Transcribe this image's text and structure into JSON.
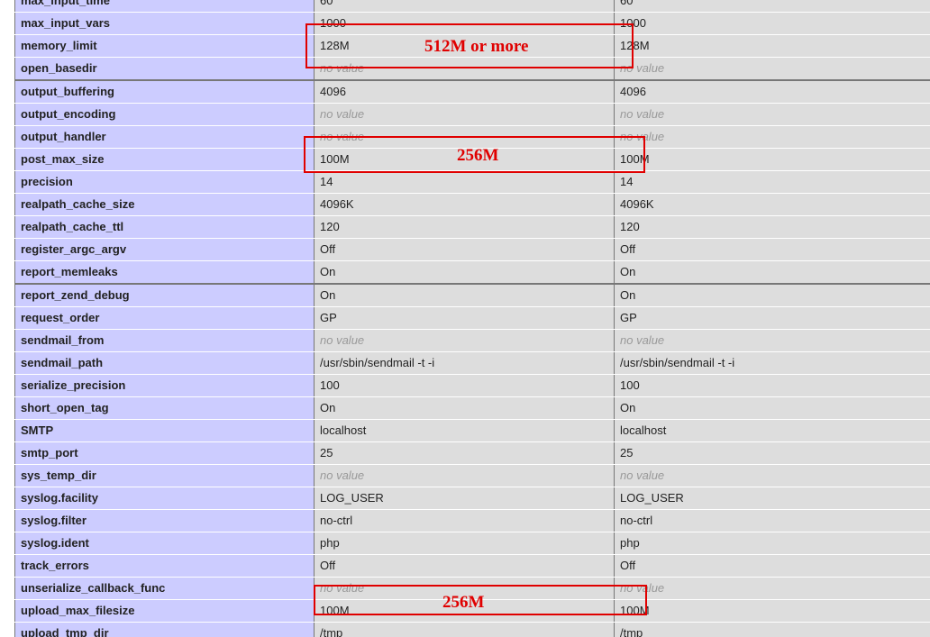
{
  "directives": [
    {
      "name": "max_input_time",
      "local": "60",
      "master": "60"
    },
    {
      "name": "max_input_vars",
      "local": "1000",
      "master": "1000"
    },
    {
      "name": "memory_limit",
      "local": "128M",
      "master": "128M"
    },
    {
      "name": "open_basedir",
      "local": "no value",
      "master": "no value",
      "no_value": true
    },
    {
      "name": "output_buffering",
      "local": "4096",
      "master": "4096",
      "separator": true
    },
    {
      "name": "output_encoding",
      "local": "no value",
      "master": "no value",
      "no_value": true
    },
    {
      "name": "output_handler",
      "local": "no value",
      "master": "no value",
      "no_value": true
    },
    {
      "name": "post_max_size",
      "local": "100M",
      "master": "100M"
    },
    {
      "name": "precision",
      "local": "14",
      "master": "14"
    },
    {
      "name": "realpath_cache_size",
      "local": "4096K",
      "master": "4096K"
    },
    {
      "name": "realpath_cache_ttl",
      "local": "120",
      "master": "120"
    },
    {
      "name": "register_argc_argv",
      "local": "Off",
      "master": "Off"
    },
    {
      "name": "report_memleaks",
      "local": "On",
      "master": "On"
    },
    {
      "name": "report_zend_debug",
      "local": "On",
      "master": "On",
      "separator": true
    },
    {
      "name": "request_order",
      "local": "GP",
      "master": "GP"
    },
    {
      "name": "sendmail_from",
      "local": "no value",
      "master": "no value",
      "no_value": true
    },
    {
      "name": "sendmail_path",
      "local": "/usr/sbin/sendmail -t -i",
      "master": "/usr/sbin/sendmail -t -i"
    },
    {
      "name": "serialize_precision",
      "local": "100",
      "master": "100"
    },
    {
      "name": "short_open_tag",
      "local": "On",
      "master": "On"
    },
    {
      "name": "SMTP",
      "local": "localhost",
      "master": "localhost"
    },
    {
      "name": "smtp_port",
      "local": "25",
      "master": "25"
    },
    {
      "name": "sys_temp_dir",
      "local": "no value",
      "master": "no value",
      "no_value": true
    },
    {
      "name": "syslog.facility",
      "local": "LOG_USER",
      "master": "LOG_USER"
    },
    {
      "name": "syslog.filter",
      "local": "no-ctrl",
      "master": "no-ctrl"
    },
    {
      "name": "syslog.ident",
      "local": "php",
      "master": "php"
    },
    {
      "name": "track_errors",
      "local": "Off",
      "master": "Off"
    },
    {
      "name": "unserialize_callback_func",
      "local": "no value",
      "master": "no value",
      "no_value": true
    },
    {
      "name": "upload_max_filesize",
      "local": "100M",
      "master": "100M"
    },
    {
      "name": "upload_tmp_dir",
      "local": "/tmp",
      "master": "/tmp"
    }
  ],
  "annotations": [
    {
      "target": "memory_limit",
      "label": "512M or more"
    },
    {
      "target": "post_max_size",
      "label": "256M"
    },
    {
      "target": "upload_max_filesize",
      "label": "256M"
    }
  ],
  "colors": {
    "name_cell_bg": "#ccccff",
    "value_cell_bg": "#dddddd",
    "no_value_text": "#999999",
    "annotation_red": "#e00000"
  }
}
